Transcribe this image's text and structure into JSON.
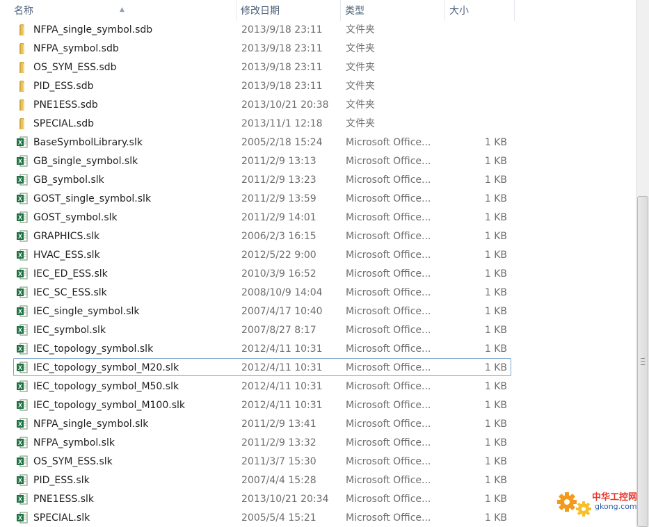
{
  "columns": {
    "name": "名称",
    "date": "修改日期",
    "type": "类型",
    "size": "大小"
  },
  "files": [
    {
      "name": "NFPA_single_symbol.sdb",
      "date": "2013/9/18 23:11",
      "type": "文件夹",
      "size": "",
      "icon": "folder-icon"
    },
    {
      "name": "NFPA_symbol.sdb",
      "date": "2013/9/18 23:11",
      "type": "文件夹",
      "size": "",
      "icon": "folder-icon"
    },
    {
      "name": "OS_SYM_ESS.sdb",
      "date": "2013/9/18 23:11",
      "type": "文件夹",
      "size": "",
      "icon": "folder-icon"
    },
    {
      "name": "PID_ESS.sdb",
      "date": "2013/9/18 23:11",
      "type": "文件夹",
      "size": "",
      "icon": "folder-icon"
    },
    {
      "name": "PNE1ESS.sdb",
      "date": "2013/10/21 20:38",
      "type": "文件夹",
      "size": "",
      "icon": "folder-icon"
    },
    {
      "name": "SPECIAL.sdb",
      "date": "2013/11/1 12:18",
      "type": "文件夹",
      "size": "",
      "icon": "folder-icon"
    },
    {
      "name": "BaseSymbolLibrary.slk",
      "date": "2005/2/18 15:24",
      "type": "Microsoft Office...",
      "size": "1 KB",
      "icon": "excel-file-icon"
    },
    {
      "name": "GB_single_symbol.slk",
      "date": "2011/2/9 13:13",
      "type": "Microsoft Office...",
      "size": "1 KB",
      "icon": "excel-file-icon"
    },
    {
      "name": "GB_symbol.slk",
      "date": "2011/2/9 13:23",
      "type": "Microsoft Office...",
      "size": "1 KB",
      "icon": "excel-file-icon"
    },
    {
      "name": "GOST_single_symbol.slk",
      "date": "2011/2/9 13:59",
      "type": "Microsoft Office...",
      "size": "1 KB",
      "icon": "excel-file-icon"
    },
    {
      "name": "GOST_symbol.slk",
      "date": "2011/2/9 14:01",
      "type": "Microsoft Office...",
      "size": "1 KB",
      "icon": "excel-file-icon"
    },
    {
      "name": "GRAPHICS.slk",
      "date": "2006/2/3 16:15",
      "type": "Microsoft Office...",
      "size": "1 KB",
      "icon": "excel-file-icon"
    },
    {
      "name": "HVAC_ESS.slk",
      "date": "2012/5/22 9:00",
      "type": "Microsoft Office...",
      "size": "1 KB",
      "icon": "excel-file-icon"
    },
    {
      "name": "IEC_ED_ESS.slk",
      "date": "2010/3/9 16:52",
      "type": "Microsoft Office...",
      "size": "1 KB",
      "icon": "excel-file-icon"
    },
    {
      "name": "IEC_SC_ESS.slk",
      "date": "2008/10/9 14:04",
      "type": "Microsoft Office...",
      "size": "1 KB",
      "icon": "excel-file-icon"
    },
    {
      "name": "IEC_single_symbol.slk",
      "date": "2007/4/17 10:40",
      "type": "Microsoft Office...",
      "size": "1 KB",
      "icon": "excel-file-icon"
    },
    {
      "name": "IEC_symbol.slk",
      "date": "2007/8/27 8:17",
      "type": "Microsoft Office...",
      "size": "1 KB",
      "icon": "excel-file-icon"
    },
    {
      "name": "IEC_topology_symbol.slk",
      "date": "2012/4/11 10:31",
      "type": "Microsoft Office...",
      "size": "1 KB",
      "icon": "excel-file-icon"
    },
    {
      "name": "IEC_topology_symbol_M20.slk",
      "date": "2012/4/11 10:31",
      "type": "Microsoft Office...",
      "size": "1 KB",
      "icon": "excel-file-icon",
      "focused": true
    },
    {
      "name": "IEC_topology_symbol_M50.slk",
      "date": "2012/4/11 10:31",
      "type": "Microsoft Office...",
      "size": "1 KB",
      "icon": "excel-file-icon"
    },
    {
      "name": "IEC_topology_symbol_M100.slk",
      "date": "2012/4/11 10:31",
      "type": "Microsoft Office...",
      "size": "1 KB",
      "icon": "excel-file-icon"
    },
    {
      "name": "NFPA_single_symbol.slk",
      "date": "2011/2/9 13:41",
      "type": "Microsoft Office...",
      "size": "1 KB",
      "icon": "excel-file-icon"
    },
    {
      "name": "NFPA_symbol.slk",
      "date": "2011/2/9 13:32",
      "type": "Microsoft Office...",
      "size": "1 KB",
      "icon": "excel-file-icon"
    },
    {
      "name": "OS_SYM_ESS.slk",
      "date": "2011/3/7 15:30",
      "type": "Microsoft Office...",
      "size": "1 KB",
      "icon": "excel-file-icon"
    },
    {
      "name": "PID_ESS.slk",
      "date": "2007/4/4 15:28",
      "type": "Microsoft Office...",
      "size": "1 KB",
      "icon": "excel-file-icon"
    },
    {
      "name": "PNE1ESS.slk",
      "date": "2013/10/21 20:34",
      "type": "Microsoft Office...",
      "size": "1 KB",
      "icon": "excel-file-icon"
    },
    {
      "name": "SPECIAL.slk",
      "date": "2005/5/4 15:21",
      "type": "Microsoft Office...",
      "size": "1 KB",
      "icon": "excel-file-icon"
    }
  ],
  "watermark": {
    "title": "中华工控网",
    "url": "gkong.com"
  },
  "colors": {
    "header_text": "#4c607a",
    "focus_border": "#7da2ce",
    "folder": "#e8c25a",
    "excel": "#1f7244"
  }
}
